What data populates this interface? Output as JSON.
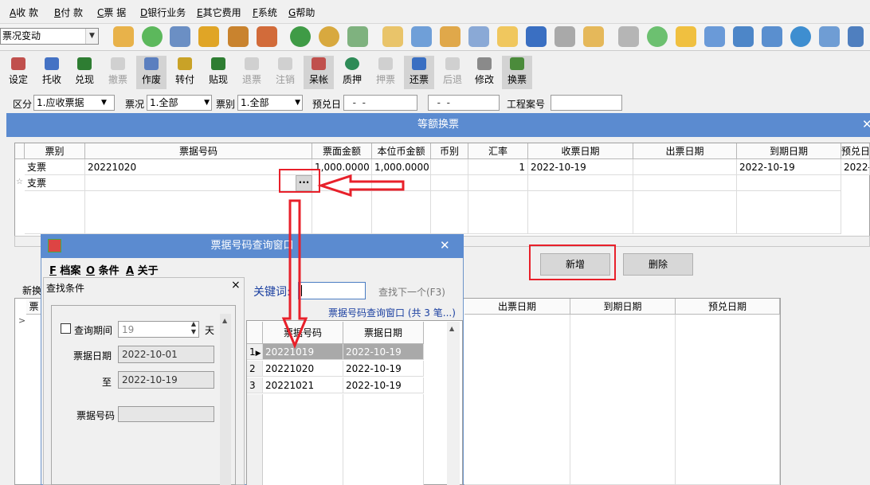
{
  "menu": [
    {
      "key": "A",
      "label": "收 款"
    },
    {
      "key": "B",
      "label": "付 款"
    },
    {
      "key": "C",
      "label": "票 据"
    },
    {
      "key": "D",
      "label": "银行业务"
    },
    {
      "key": "E",
      "label": "其它费用"
    },
    {
      "key": "F",
      "label": "系统"
    },
    {
      "key": "G",
      "label": "帮助"
    }
  ],
  "module_select": "票况变动",
  "toolbar": [
    "设定",
    "托收",
    "兑现",
    "撤票",
    "作废",
    "转付",
    "贴现",
    "退票",
    "注销",
    "呆帐",
    "质押",
    "押票",
    "还票",
    "后退",
    "修改",
    "换票"
  ],
  "filter": {
    "qufen_label": "区分",
    "qufen_value": "1.应收票据",
    "piaokuang_label": "票况",
    "piaokuang_value": "1.全部",
    "piaobie_label": "票别",
    "piaobie_value": "1.全部",
    "yuduiri_label": "预兑日",
    "date_from": "  -  -",
    "date_to": "  -  -",
    "gongcheng_label": "工程案号"
  },
  "dialog": {
    "title": "等额换票",
    "columns": [
      "票别",
      "票据号码",
      "票面金额",
      "本位币金额",
      "币别",
      "汇率",
      "收票日期",
      "出票日期",
      "到期日期",
      "预兑日期"
    ],
    "rows": [
      {
        "piaobie": "支票",
        "haoma": "20221020",
        "mianjine": "1,000.0000",
        "benweibi": "1,000.0000",
        "bibie": "",
        "huilv": "1",
        "shoupiao": "2022-10-19",
        "chupiao": "",
        "daoqi": "2022-10-19",
        "yudui": "2022-"
      },
      {
        "piaobie": "支票"
      }
    ],
    "ellipsis": "···",
    "add_button": "新增",
    "delete_button": "删除",
    "lower_label": "新换",
    "lower_columns": [
      "票",
      "出票日期",
      "到期日期",
      "预兑日期"
    ]
  },
  "query": {
    "title": "票据号码查询窗口",
    "menu": [
      {
        "key": "F",
        "label": "档案"
      },
      {
        "key": "O",
        "label": "条件"
      },
      {
        "key": "A",
        "label": "关于"
      }
    ],
    "panel_title": "查找条件",
    "close": "×",
    "period_label": "查询期间",
    "period_value": "19",
    "period_unit": "天",
    "date_label": "票据日期",
    "date_from": "2022-10-01",
    "to_label": "至",
    "date_to": "2022-10-19",
    "number_label": "票据号码",
    "keyword_label": "关键词:",
    "find_next": "查找下一个(F3)",
    "result_caption": "票据号码查询窗口 (共 3 笔...)",
    "result_columns": [
      "票据号码",
      "票据日期"
    ],
    "results": [
      {
        "idx": "1",
        "no": "20221019",
        "date": "2022-10-19"
      },
      {
        "idx": "2",
        "no": "20221020",
        "date": "2022-10-19"
      },
      {
        "idx": "3",
        "no": "20221021",
        "date": "2022-10-19"
      }
    ]
  },
  "colors": {
    "title_bar": "#5b8bd0",
    "highlight": "#e8202a",
    "selected_row": "#a9a9a9"
  }
}
